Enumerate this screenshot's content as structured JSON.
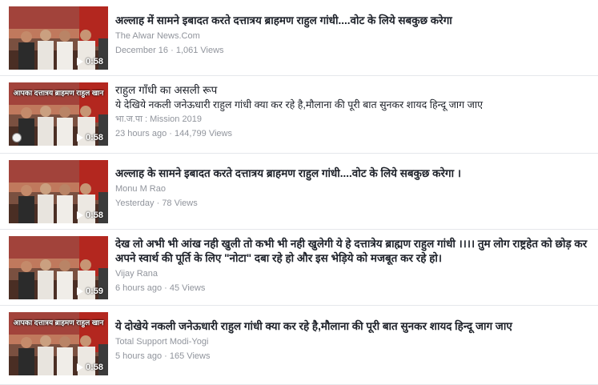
{
  "videos": [
    {
      "title": "अल्लाह में सामने इबादत करते दत्तात्रय ब्राहमण राहुल गांधी....वोट के लिये सबकुछ करेगा",
      "title_bold": true,
      "description": "",
      "source": "The Alwar News.Com",
      "date": "December 16",
      "views": "1,061 Views",
      "duration": "0:58",
      "thumb_text": "",
      "thumb_logo": false
    },
    {
      "title": "राहुल गाँधी का असली रूप",
      "title_bold": false,
      "description": "ये देखिये नकली जनेऊधारी राहुल गांधी क्या कर रहे है,मौलाना की पूरी बात सुनकर शायद हिन्दू जाग जाए",
      "source": "भा.ज.पा : Mission 2019",
      "date": "23 hours ago",
      "views": "144,799 Views",
      "duration": "0:58",
      "thumb_text": "आपका दत्तात्रय ब्राहमण राहुल खान",
      "thumb_logo": true
    },
    {
      "title": "अल्लाह के सामने इबादत करते दत्तात्रय ब्राहमण राहुल गांधी....वोट के लिये सबकुछ करेगा ।",
      "title_bold": true,
      "description": "",
      "source": "Monu M Rao",
      "date": "Yesterday",
      "views": "78 Views",
      "duration": "0:58",
      "thumb_text": "",
      "thumb_logo": false
    },
    {
      "title": "देख लो अभी भी आंख नही खुली तो कभी भी नही खुलेगी ये हे दत्तात्रेय ब्राह्मण राहुल गांधी ।।।। तुम लोग राष्ट्रहेत को छोड़ कर अपने स्वार्थ की पूर्ति के लिए \"नोटा\" दबा रहे हो और इस भेड़िये को मजबूत कर रहे हो।",
      "title_bold": true,
      "description": "",
      "source": "Vijay Rana",
      "date": "6 hours ago",
      "views": "45 Views",
      "duration": "0:59",
      "thumb_text": "",
      "thumb_logo": false
    },
    {
      "title": "ये दोखेये नकली जनेऊधारी राहुल गांधी क्या कर रहे है,मौलाना की पूरी बात सुनकर शायद हिन्दू जाग जाए",
      "title_bold": true,
      "description": "",
      "source": "Total Support Modi-Yogi",
      "date": "5 hours ago",
      "views": "165 Views",
      "duration": "0:58",
      "thumb_text": "आपका दत्तात्रय ब्राहमण राहुल खान",
      "thumb_logo": false
    }
  ],
  "separator": " · ",
  "colors": {
    "title": "#1d2129",
    "secondary": "#90949c",
    "divider": "#e5e7eb"
  },
  "icons": {
    "play": "play-icon",
    "logo": "logo-icon"
  }
}
